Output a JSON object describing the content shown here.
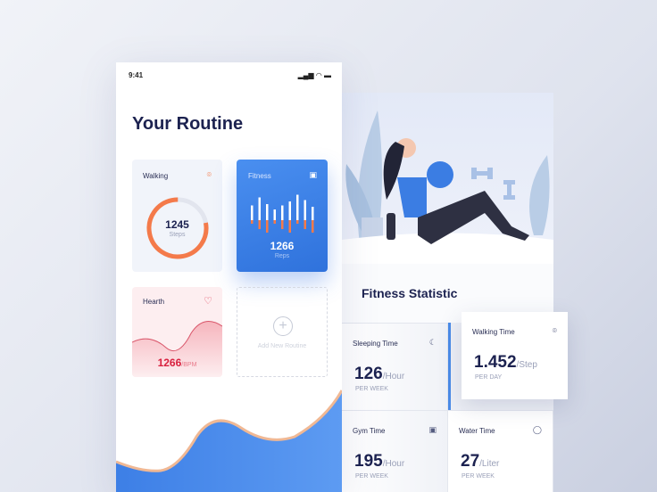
{
  "status": {
    "time": "9:41"
  },
  "title": "Your Routine",
  "walking": {
    "label": "Walking",
    "value": "1245",
    "unit": "Steps",
    "progress": 0.78,
    "color": "#f47a4a"
  },
  "fitness": {
    "label": "Fitness",
    "value": "1266",
    "unit": "Reps",
    "bars": [
      0.55,
      0.85,
      0.6,
      0.4,
      0.55,
      0.7,
      0.95,
      0.75,
      0.5
    ]
  },
  "hearth": {
    "label": "Hearth",
    "value": "1266",
    "unit": "/BPM"
  },
  "add": {
    "label": "Add New Routine"
  },
  "stats_title": "Fitness Statistic",
  "stats": [
    {
      "label": "Sleeping Time",
      "value": "126",
      "unit": "/Hour",
      "period": "PER WEEK",
      "icon": "☾"
    },
    {
      "label": "Walking Time",
      "value": "1.452",
      "unit": "/Step",
      "period": "PER DAY",
      "icon": "⌾"
    },
    {
      "label": "Gym Time",
      "value": "195",
      "unit": "/Hour",
      "period": "PER WEEK",
      "icon": "▣"
    },
    {
      "label": "Water Time",
      "value": "27",
      "unit": "/Liter",
      "period": "PER WEEK",
      "icon": "◯"
    }
  ]
}
